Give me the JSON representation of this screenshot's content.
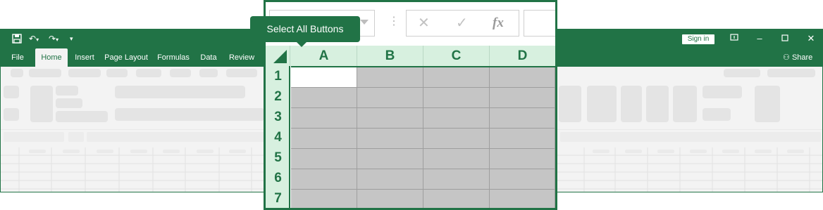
{
  "ribbon": {
    "tabs": [
      "File",
      "Home",
      "Insert",
      "Page Layout",
      "Formulas",
      "Data",
      "Review"
    ],
    "sign_in": "Sign in",
    "share": "Share"
  },
  "formula_bar": {
    "cancel_glyph": "✕",
    "enter_glyph": "✓",
    "fx_label": "fx"
  },
  "tooltip": "Select All Buttons",
  "grid": {
    "columns": [
      "A",
      "B",
      "C",
      "D"
    ],
    "rows": [
      "1",
      "2",
      "3",
      "4",
      "5",
      "6",
      "7"
    ]
  },
  "colors": {
    "excel_green": "#217346",
    "header_fill": "#d7f0df",
    "selected_cell": "#c5c5c5",
    "active_cell": "#ffffff"
  }
}
